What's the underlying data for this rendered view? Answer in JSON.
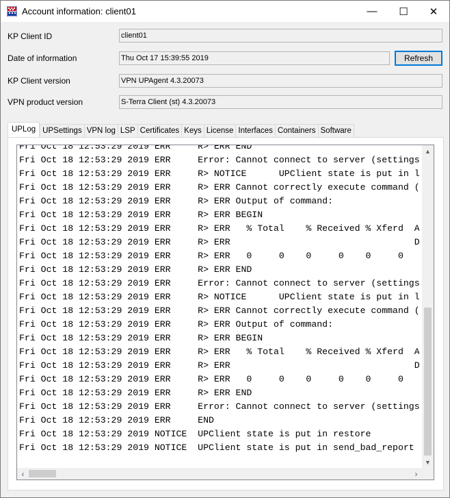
{
  "window": {
    "title": "Account information: client01",
    "min_symbol": "—",
    "max_symbol": "☐",
    "close_symbol": "✕"
  },
  "info": {
    "client_id_label": "KP Client ID",
    "client_id_value": "client01",
    "date_label": "Date of information",
    "date_value": "Thu Oct 17 15:39:55 2019",
    "refresh_label": "Refresh",
    "client_version_label": "KP Client version",
    "client_version_value": "VPN UPAgent 4.3.20073",
    "product_version_label": "VPN product version",
    "product_version_value": "S-Terra Client (st) 4.3.20073"
  },
  "tabs": [
    "UPLog",
    "UPSettings",
    "VPN log",
    "LSP",
    "Certificates",
    "Keys",
    "License",
    "Interfaces",
    "Containers",
    "Software"
  ],
  "active_tab": "UPLog",
  "log": [
    "Fri Oct 18 12:53:29 2019 ERR     R> ERR END",
    "Fri Oct 18 12:53:29 2019 ERR     Error: Cannot connect to server (settings",
    "Fri Oct 18 12:53:29 2019 ERR     R> NOTICE      UPClient state is put in l",
    "Fri Oct 18 12:53:29 2019 ERR     R> ERR Cannot correctly execute command (",
    "Fri Oct 18 12:53:29 2019 ERR     R> ERR Output of command:",
    "Fri Oct 18 12:53:29 2019 ERR     R> ERR BEGIN",
    "Fri Oct 18 12:53:29 2019 ERR     R> ERR   % Total    % Received % Xferd  A",
    "Fri Oct 18 12:53:29 2019 ERR     R> ERR                                  D",
    "Fri Oct 18 12:53:29 2019 ERR     R> ERR   0     0    0     0    0     0",
    "Fri Oct 18 12:53:29 2019 ERR     R> ERR END",
    "Fri Oct 18 12:53:29 2019 ERR     Error: Cannot connect to server (settings",
    "Fri Oct 18 12:53:29 2019 ERR     R> NOTICE      UPClient state is put in l",
    "Fri Oct 18 12:53:29 2019 ERR     R> ERR Cannot correctly execute command (",
    "Fri Oct 18 12:53:29 2019 ERR     R> ERR Output of command:",
    "Fri Oct 18 12:53:29 2019 ERR     R> ERR BEGIN",
    "Fri Oct 18 12:53:29 2019 ERR     R> ERR   % Total    % Received % Xferd  A",
    "Fri Oct 18 12:53:29 2019 ERR     R> ERR                                  D",
    "Fri Oct 18 12:53:29 2019 ERR     R> ERR   0     0    0     0    0     0",
    "Fri Oct 18 12:53:29 2019 ERR     R> ERR END",
    "Fri Oct 18 12:53:29 2019 ERR     Error: Cannot connect to server (settings",
    "Fri Oct 18 12:53:29 2019 ERR     END",
    "Fri Oct 18 12:53:29 2019 NOTICE  UPClient state is put in restore",
    "Fri Oct 18 12:53:29 2019 NOTICE  UPClient state is put in send_bad_report"
  ]
}
